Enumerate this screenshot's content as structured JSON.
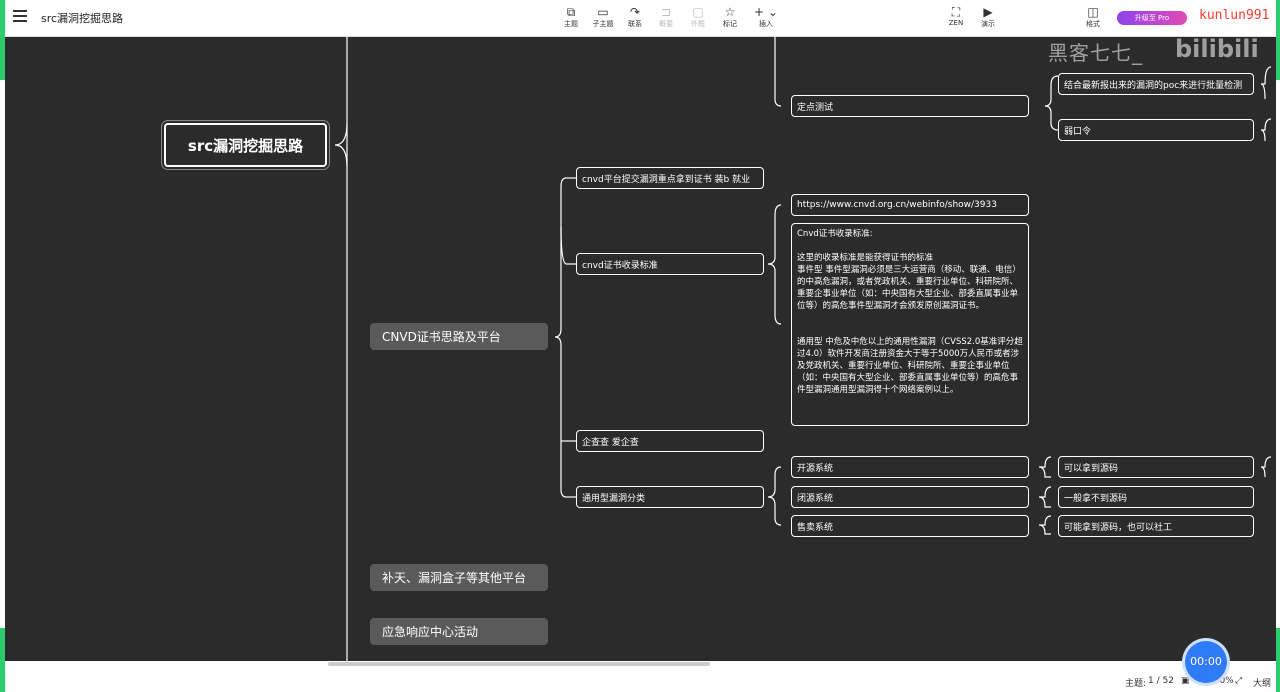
{
  "window": {
    "title": "src漏洞挖掘思路"
  },
  "toolbar": {
    "items": [
      {
        "label": "主题",
        "icon": "topic-icon"
      },
      {
        "label": "子主题",
        "icon": "subtopic-icon"
      },
      {
        "label": "联系",
        "icon": "relation-icon"
      },
      {
        "label": "概要",
        "icon": "summary-icon"
      },
      {
        "label": "外框",
        "icon": "boundary-icon"
      },
      {
        "label": "标记",
        "icon": "marker-icon"
      },
      {
        "label": "插入",
        "icon": "insert-icon"
      },
      {
        "label": "ZEN",
        "icon": "zen-icon"
      },
      {
        "label": "演示",
        "icon": "present-icon"
      },
      {
        "label": "格式",
        "icon": "format-icon"
      }
    ],
    "upgrade_label": "升级至 Pro"
  },
  "watermark": {
    "user": "kunlun991",
    "channel": "黑客七七_",
    "site": "bilibili"
  },
  "mindmap": {
    "root": "src漏洞挖掘思路",
    "branches": [
      "CNVD证书思路及平台",
      "补天、漏洞盒子等其他平台",
      "应急响应中心活动"
    ],
    "cnvd_children": [
      "cnvd平台提交漏洞重点拿到证书 装b 就业",
      "cnvd证书收录标准",
      "企查查 爱企查",
      "通用型漏洞分类"
    ],
    "standard_url": "https://www.cnvd.org.cn/webinfo/show/3933",
    "standard_detail": "Cnvd证书收录标准:\n\n这里的收录标准是能获得证书的标准\n事件型 事件型漏洞必须是三大运营商（移动、联通、电信）的中高危漏洞，或者党政机关、重要行业单位、科研院所、重要企事业单位（如：中央国有大型企业、部委直属事业单位等）的高危事件型漏洞才会颁发原创漏洞证书。\n\n\n通用型 中危及中危以上的通用性漏洞（CVSS2.0基准评分超过4.0）软件开发商注册资金大于等于5000万人民币或者涉及党政机关、重要行业单位、科研院所、重要企事业单位（如：中央国有大型企业、部委直属事业单位等）的高危事件型漏洞通用型漏洞得十个网络案例以上。",
    "fixed_test": "定点测试",
    "fixed_test_children": [
      "结合最新报出来的漏洞的poc来进行批量检测",
      "弱口令"
    ],
    "vuln_types": [
      {
        "name": "开源系统",
        "note": "可以拿到源码"
      },
      {
        "name": "闭源系统",
        "note": "一般拿不到源码"
      },
      {
        "name": "售卖系统",
        "note": "可能拿到源码，也可以社工"
      }
    ]
  },
  "status": {
    "topics_label": "主题:",
    "topics_value": "1 / 52",
    "zoom": "100%",
    "zoom_action": "大纲"
  },
  "timer": "00:00"
}
